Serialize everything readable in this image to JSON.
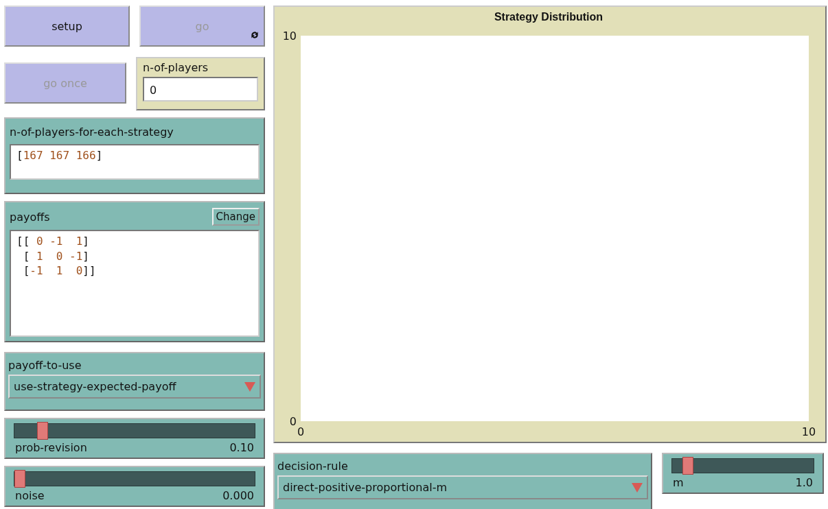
{
  "left_widgets": [
    {
      "kind": "button_row",
      "items": [
        {
          "label": "setup",
          "disabled": false,
          "forever": false
        },
        {
          "label": "go",
          "disabled": true,
          "forever": true
        }
      ]
    },
    {
      "kind": "button_monitor_row",
      "button": {
        "label": "go once",
        "disabled": true
      },
      "input": {
        "label": "n-of-players",
        "value": "0"
      }
    },
    {
      "kind": "input",
      "label": "n-of-players-for-each-strategy",
      "value": "[167 167 166]"
    },
    {
      "kind": "matrix",
      "label": "payoffs",
      "button": "Change",
      "value": "[[ 0 -1  1]\n [ 1  0 -1]\n [-1  1  0]]"
    },
    {
      "kind": "chooser",
      "label": "payoff-to-use",
      "value": "use-strategy-expected-payoff"
    },
    {
      "kind": "slider",
      "label": "prob-revision",
      "reading": "0.10",
      "level": 0.1
    },
    {
      "kind": "slider",
      "label": "noise",
      "reading": "0.000",
      "level": 0
    }
  ],
  "plot": {
    "chart_data": {
      "type": "line",
      "title": "Strategy Distribution",
      "xlim": [
        0,
        10
      ],
      "ylim": [
        0,
        10
      ],
      "xticks": [
        0,
        10
      ],
      "yticks": [
        0,
        10
      ]
    }
  },
  "decision_rule": {
    "label": "decision-rule",
    "value": "direct-positive-proportional-m"
  },
  "m_slider": {
    "label": "m",
    "reading": "1.0",
    "level": 0.08
  }
}
